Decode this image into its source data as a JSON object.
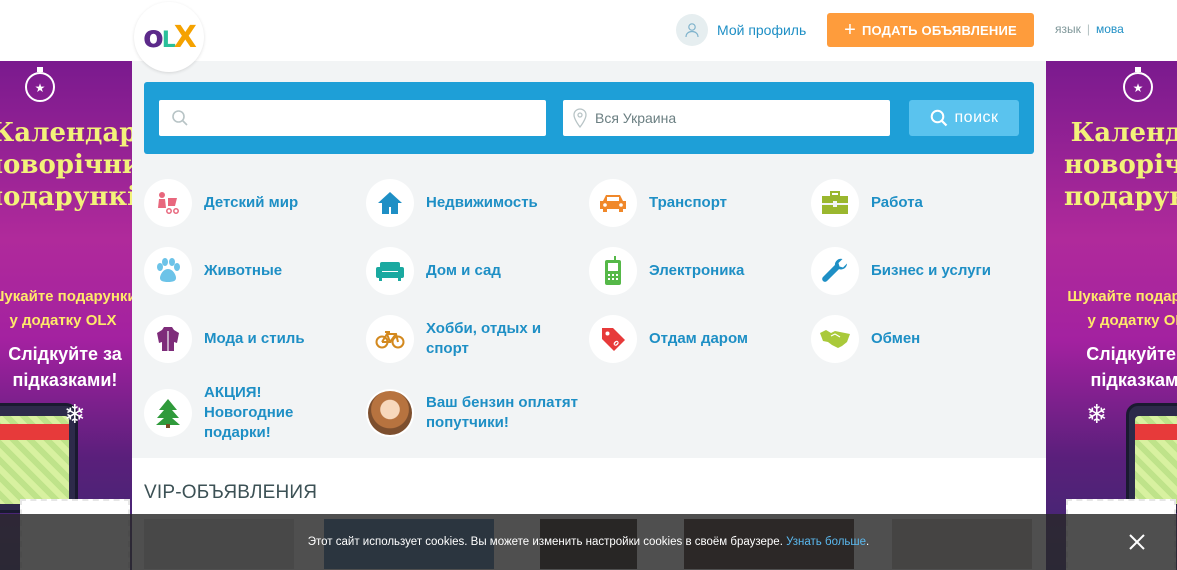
{
  "header": {
    "logo": "OLX",
    "profile_label": "Мой профиль",
    "post_ad_label": "ПОДАТЬ ОБЪЯВЛЕНИЕ",
    "lang_current": "язык",
    "lang_alt": "мова"
  },
  "banner": {
    "title": "Календар новорічних подарунків",
    "subtitle": "Шукайте подарунки у додатку OLX",
    "subtitle2": "Слідкуйте за підказками!"
  },
  "search": {
    "query_placeholder": "",
    "location_value": "Вся Украина",
    "button_label": "поиск"
  },
  "categories": [
    {
      "label": "Детский мир",
      "icon": "stroller-icon",
      "color": "#e8677d"
    },
    {
      "label": "Недвижимость",
      "icon": "house-icon",
      "color": "#1e8fc5"
    },
    {
      "label": "Транспорт",
      "icon": "car-icon",
      "color": "#f0882a"
    },
    {
      "label": "Работа",
      "icon": "briefcase-icon",
      "color": "#9ab72e"
    },
    {
      "label": "Животные",
      "icon": "paw-icon",
      "color": "#6cc3e8"
    },
    {
      "label": "Дом и сад",
      "icon": "sofa-icon",
      "color": "#1aa9a0"
    },
    {
      "label": "Электроника",
      "icon": "phone-icon",
      "color": "#55b848"
    },
    {
      "label": "Бизнес и услуги",
      "icon": "wrench-icon",
      "color": "#1e8fc5"
    },
    {
      "label": "Мода и стиль",
      "icon": "jacket-icon",
      "color": "#7e2c7a"
    },
    {
      "label": "Хобби, отдых и спорт",
      "icon": "bicycle-icon",
      "color": "#d3891f"
    },
    {
      "label": "Отдам даром",
      "icon": "tag-icon",
      "color": "#e73a3a"
    },
    {
      "label": "Обмен",
      "icon": "handshake-icon",
      "color": "#a9c93a"
    },
    {
      "label": "АКЦИЯ! Новогодние подарки!",
      "icon": "tree-icon",
      "color": "#2f9a3b"
    },
    {
      "label": "Ваш бензин оплатят попутчики!",
      "icon": "person-photo",
      "color": "#b7733f"
    }
  ],
  "vip": {
    "title": "VIP-ОБЪЯВЛЕНИЯ"
  },
  "cookie": {
    "text": "Этот сайт использует cookies. Вы можете изменить настройки cookies в своём браузере.",
    "link": "Узнать больше",
    "end": "."
  }
}
